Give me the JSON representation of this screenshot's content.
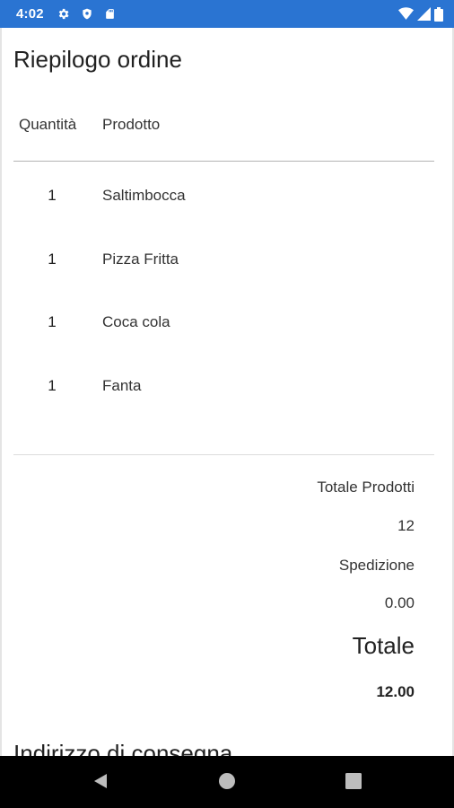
{
  "status_bar": {
    "time": "4:02",
    "left_icons": [
      "gear-icon",
      "shield-icon",
      "sd-card-icon"
    ],
    "right_icons": [
      "wifi-icon",
      "signal-icon",
      "battery-icon"
    ],
    "background": "#2a74d2"
  },
  "page": {
    "title": "Riepilogo ordine"
  },
  "table": {
    "headers": {
      "quantity": "Quantità",
      "product": "Prodotto"
    },
    "rows": [
      {
        "qty": "1",
        "product": "Saltimbocca"
      },
      {
        "qty": "1",
        "product": "Pizza Fritta"
      },
      {
        "qty": "1",
        "product": "Coca cola"
      },
      {
        "qty": "1",
        "product": "Fanta"
      }
    ]
  },
  "summary": {
    "products_total_label": "Totale Prodotti",
    "products_total_value": "12",
    "shipping_label": "Spedizione",
    "shipping_value": "0.00",
    "total_label": "Totale",
    "total_value": "12.00"
  },
  "delivery": {
    "section_title": "Indirizzo di consegna"
  },
  "nav_bar": {
    "buttons": [
      "back-icon",
      "home-icon",
      "recents-icon"
    ]
  }
}
